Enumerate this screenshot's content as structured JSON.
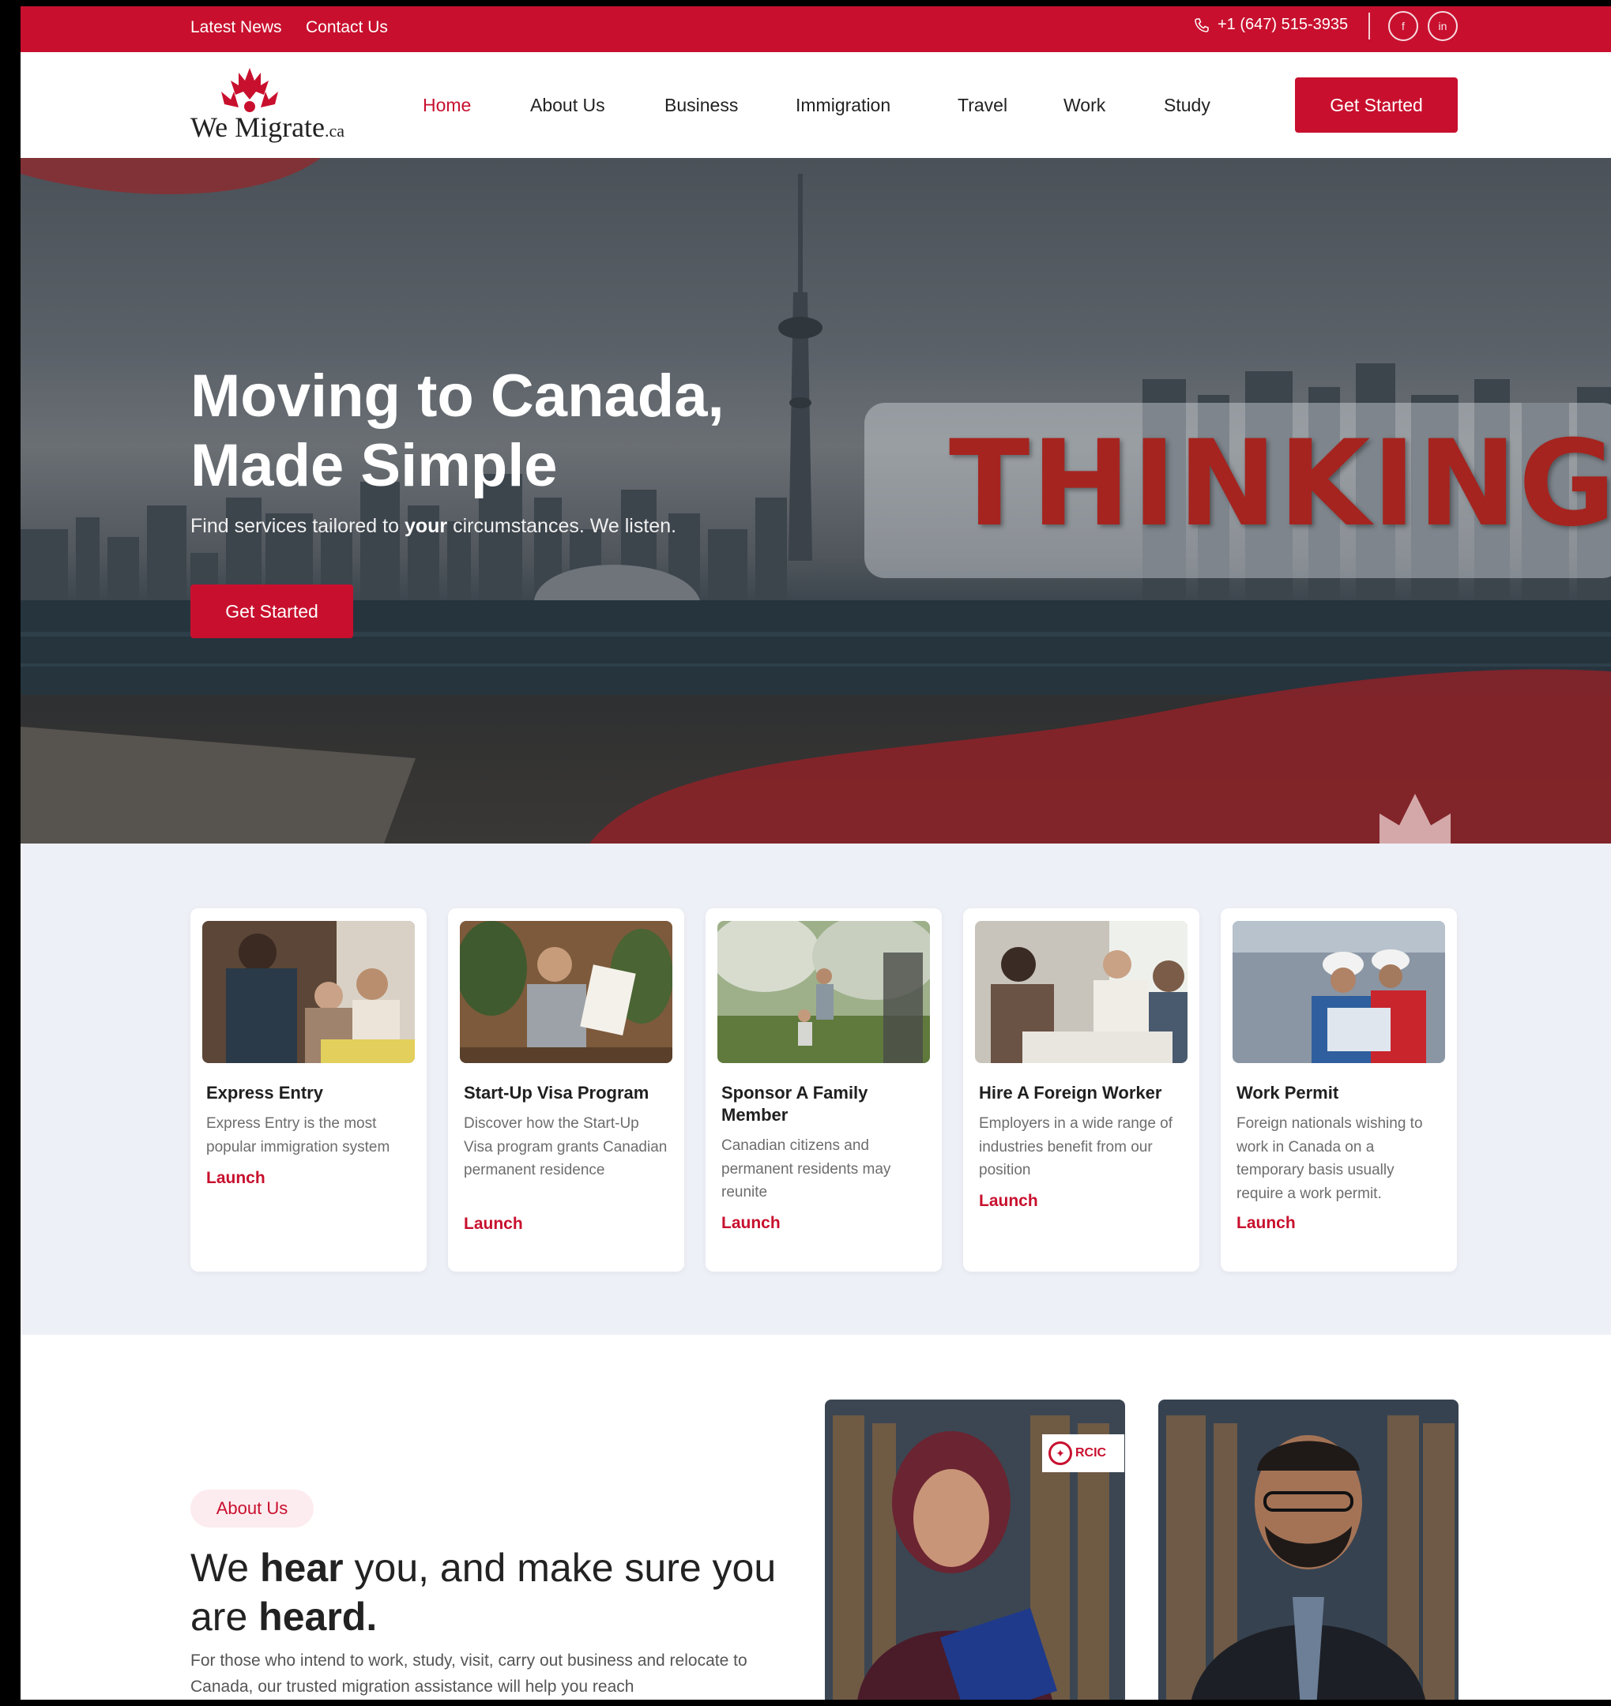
{
  "topbar": {
    "links": [
      "Latest News",
      "Contact Us"
    ],
    "phone": "+1 (647) 515-3935",
    "social": [
      "facebook-icon",
      "linkedin-icon"
    ]
  },
  "header": {
    "logo_text": "We Migrate",
    "logo_suffix": ".ca",
    "nav": [
      "Home",
      "About Us",
      "Business",
      "Immigration",
      "Travel",
      "Work",
      "Study"
    ],
    "active_nav": "Home",
    "cta": "Get Started"
  },
  "hero": {
    "title_line1": "Moving to Canada,",
    "title_line2": "Made Simple",
    "subtitle_before": "Find services tailored to ",
    "subtitle_bold": "your",
    "subtitle_after": " circumstances. We listen.",
    "cta": "Get Started",
    "overlay_word": "THINKING"
  },
  "services": [
    {
      "title": "Express Entry",
      "description": "Express Entry is the most popular immigration system",
      "link": "Launch"
    },
    {
      "title": "Start-Up Visa Program",
      "description": "Discover how the Start-Up Visa program grants Canadian permanent residence",
      "link": "Launch"
    },
    {
      "title": "Sponsor A Family Member",
      "description": "Canadian citizens and permanent residents may reunite",
      "link": "Launch"
    },
    {
      "title": "Hire A Foreign Worker",
      "description": "Employers in a wide range of industries benefit from our position",
      "link": "Launch"
    },
    {
      "title": "Work Permit",
      "description": "Foreign nationals wishing to work in Canada on a temporary basis usually require a work permit.",
      "link": "Launch"
    }
  ],
  "about": {
    "pill": "About Us",
    "heading_1": "We ",
    "heading_bold1": "hear",
    "heading_2": " you, and make sure you are ",
    "heading_bold2": "heard.",
    "paragraph": "For those who intend to work, study, visit, carry out business and relocate to Canada, our trusted migration assistance will help you reach",
    "badge": "RCIC"
  },
  "colors": {
    "brand_red": "#c8102e",
    "services_bg": "#eef0f7"
  }
}
